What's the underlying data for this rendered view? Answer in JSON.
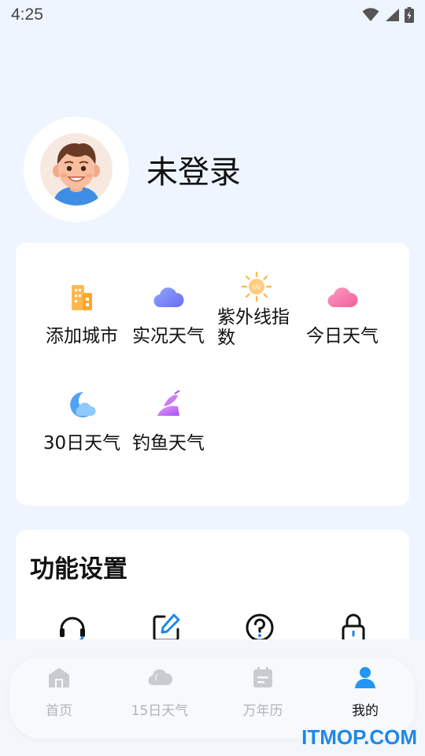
{
  "status_bar": {
    "time": "4:25"
  },
  "profile": {
    "username": "未登录"
  },
  "quick_actions": [
    {
      "label": "添加城市",
      "icon": "building-icon"
    },
    {
      "label": "实况天气",
      "icon": "cloud-icon"
    },
    {
      "label": "紫外线指数",
      "icon": "uv-sun-icon"
    },
    {
      "label": "今日天气",
      "icon": "pink-cloud-icon"
    },
    {
      "label": "30日天气",
      "icon": "moon-cloud-icon"
    },
    {
      "label": "钓鱼天气",
      "icon": "fishing-icon"
    }
  ],
  "settings": {
    "title": "功能设置",
    "icons": [
      "headset-icon",
      "edit-icon",
      "help-icon",
      "lock-icon"
    ]
  },
  "tabs": [
    {
      "label": "首页",
      "icon": "home-icon",
      "active": false
    },
    {
      "label": "15日天气",
      "icon": "cloud-tab-icon",
      "active": false
    },
    {
      "label": "万年历",
      "icon": "calendar-icon",
      "active": false
    },
    {
      "label": "我的",
      "icon": "user-icon",
      "active": true
    }
  ],
  "watermark": "ITMOP.COM",
  "colors": {
    "accent": "#1e88e5",
    "background": "#eef5ff",
    "active_tab": "#2196f3",
    "inactive_tab": "#c8ccd2"
  }
}
